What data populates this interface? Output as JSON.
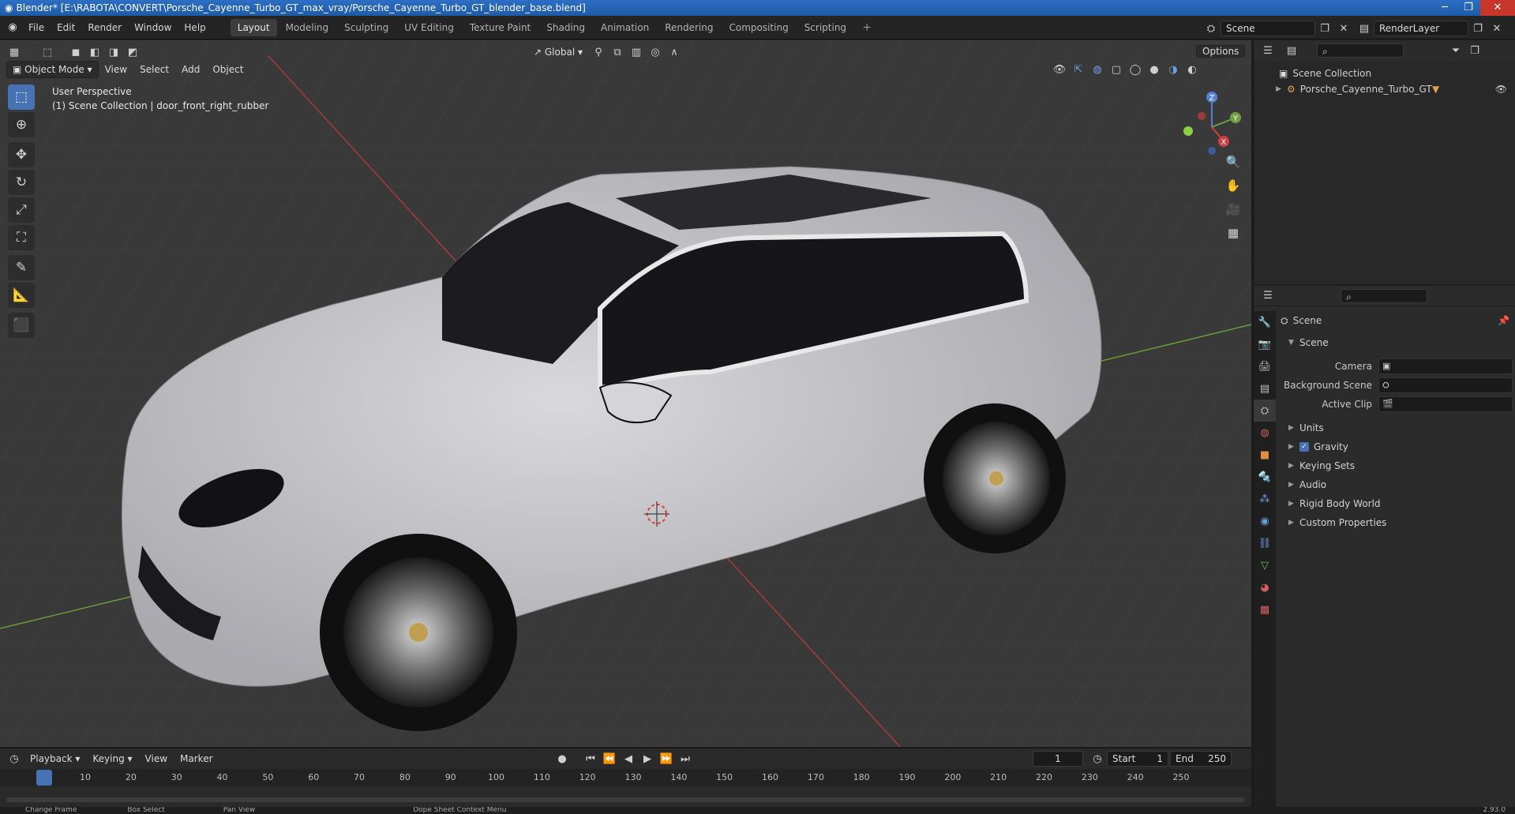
{
  "window": {
    "title": "Blender* [E:\\RABOTA\\CONVERT\\Porsche_Cayenne_Turbo_GT_max_vray/Porsche_Cayenne_Turbo_GT_blender_base.blend]"
  },
  "menu": [
    "File",
    "Edit",
    "Render",
    "Window",
    "Help"
  ],
  "workspaces": [
    "Layout",
    "Modeling",
    "Sculpting",
    "UV Editing",
    "Texture Paint",
    "Shading",
    "Animation",
    "Rendering",
    "Compositing",
    "Scripting"
  ],
  "active_workspace": "Layout",
  "scene_field": "Scene",
  "renderlayer_field": "RenderLayer",
  "viewport": {
    "mode": "Object Mode",
    "menus": [
      "View",
      "Select",
      "Add",
      "Object"
    ],
    "transform_orientation": "Global",
    "options_label": "Options",
    "overlay_line1": "User Perspective",
    "overlay_line2": "(1) Scene Collection | door_front_right_rubber",
    "gizmo": {
      "x": "X",
      "y": "Y",
      "z": "Z"
    }
  },
  "outliner": {
    "root": "Scene Collection",
    "items": [
      {
        "name": "Porsche_Cayenne_Turbo_GT"
      }
    ]
  },
  "properties": {
    "header": "Scene",
    "section": "Scene",
    "rows": [
      {
        "label": "Camera"
      },
      {
        "label": "Background Scene"
      },
      {
        "label": "Active Clip"
      }
    ],
    "panels": [
      "Units",
      "Gravity",
      "Keying Sets",
      "Audio",
      "Rigid Body World",
      "Custom Properties"
    ],
    "gravity_checked": true
  },
  "timeline": {
    "menus": [
      "Playback",
      "Keying",
      "View",
      "Marker"
    ],
    "current_frame": "1",
    "start_label": "Start",
    "start": "1",
    "end_label": "End",
    "end": "250",
    "ticks": [
      "1",
      "10",
      "20",
      "30",
      "40",
      "50",
      "60",
      "70",
      "80",
      "90",
      "100",
      "110",
      "120",
      "130",
      "140",
      "150",
      "160",
      "170",
      "180",
      "190",
      "200",
      "210",
      "220",
      "230",
      "240",
      "250"
    ]
  },
  "status": {
    "items": [
      "Change Frame",
      "Box Select",
      "Pan View",
      "Dope Sheet Context Menu"
    ],
    "version": "2.93.0"
  },
  "colors": {
    "accent": "#4772b3",
    "bg": "#393939",
    "panel": "#2b2b2b"
  }
}
